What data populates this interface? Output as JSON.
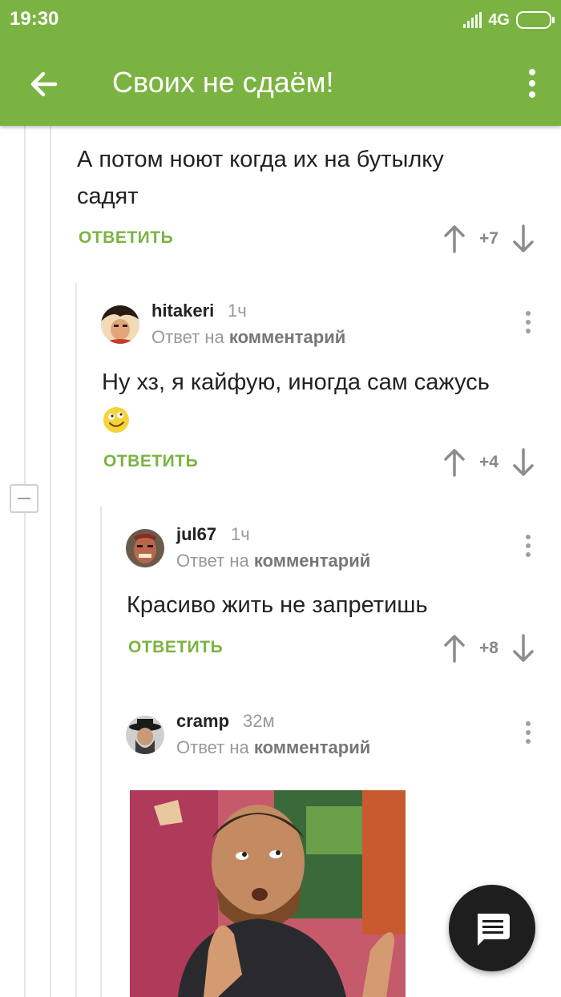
{
  "status_bar": {
    "time": "19:30",
    "network": "4G"
  },
  "app_bar": {
    "title": "Своих не сдаём!"
  },
  "actions": {
    "reply_label": "ОТВЕТИТЬ",
    "reply_to_prefix": "Ответ на",
    "reply_to_link": "комментарий"
  },
  "comments": [
    {
      "text": "А потом ноют когда их на бутылку садят",
      "score": "+7"
    },
    {
      "username": "hitakeri",
      "time": "1ч",
      "text": "Ну хз, я кайфую, иногда сам сажусь",
      "score": "+4"
    },
    {
      "username": "jul67",
      "time": "1ч",
      "text": "Красиво жить не запретишь",
      "score": "+8"
    },
    {
      "username": "cramp",
      "time": "32м"
    }
  ],
  "colors": {
    "accent": "#7bb342",
    "fab": "#1e1e1e"
  }
}
